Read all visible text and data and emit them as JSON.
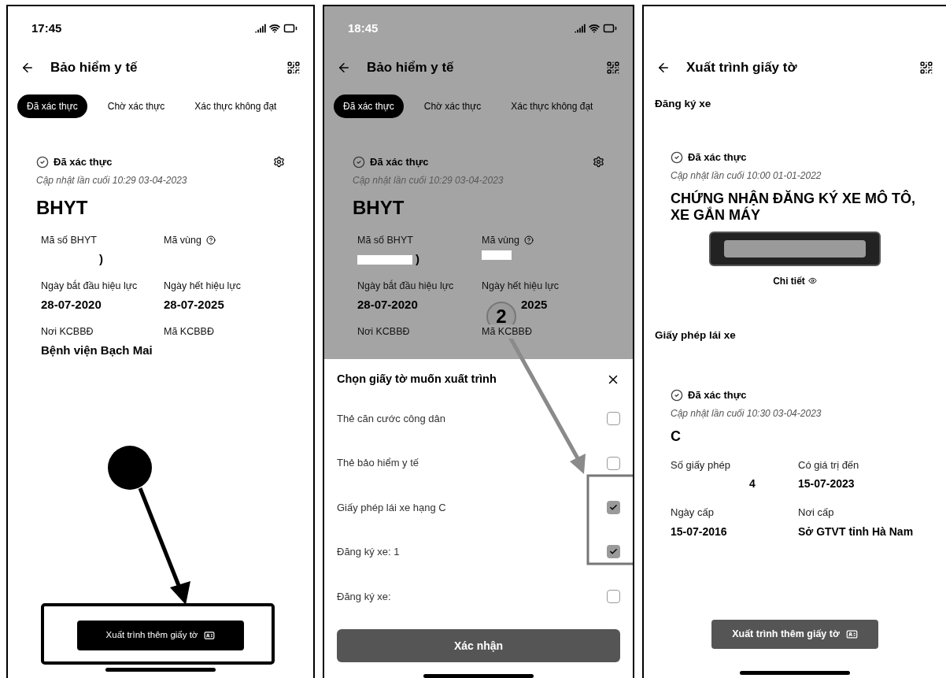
{
  "panels": [
    {
      "kind": "detail",
      "status_bar": {
        "time": "17:45"
      },
      "header": {
        "title": "Bảo hiểm y tế"
      },
      "tabs": [
        {
          "label": "Đã xác thực",
          "selected": true
        },
        {
          "label": "Chờ xác thực",
          "selected": false
        },
        {
          "label": "Xác thực không đạt",
          "selected": false
        }
      ],
      "card": {
        "status": "Đã xác thực",
        "updated": "Cập nhật lần cuối 10:29 03-04-2023",
        "title": "BHYT",
        "fields": [
          {
            "label": "Mã số BHYT",
            "value": ")",
            "redacted": true
          },
          {
            "label": "Mã vùng",
            "help": true
          },
          {
            "label": "Ngày bắt đầu hiệu lực",
            "value": "28-07-2020"
          },
          {
            "label": "Ngày hết hiệu lực",
            "value": "28-07-2025"
          },
          {
            "label": "Nơi KCBBĐ",
            "value": "Bệnh viện Bạch Mai"
          },
          {
            "label": "Mã KCBBĐ"
          }
        ]
      },
      "action_button": {
        "label": "Xuất trình thêm giấy tờ"
      },
      "annotation": {
        "kind": "button_callout"
      }
    },
    {
      "kind": "detail",
      "dimmed": true,
      "status_bar": {
        "time": "18:45"
      },
      "header": {
        "title": "Bảo hiểm y tế"
      },
      "tabs": [
        {
          "label": "Đã xác thực",
          "selected": true
        },
        {
          "label": "Chờ xác thực",
          "selected": false
        },
        {
          "label": "Xác thực không đạt",
          "selected": false
        }
      ],
      "card": {
        "status": "Đã xác thực",
        "updated": "Cập nhật lần cuối 10:29 03-04-2023",
        "title": "BHYT",
        "fields": [
          {
            "label": "Mã số BHYT",
            "value": ")",
            "redacted": true
          },
          {
            "label": "Mã vùng",
            "redacted": true,
            "help": true
          },
          {
            "label": "Ngày bắt đầu hiệu lực",
            "value": "28-07-2020"
          },
          {
            "label": "Ngày hết hiệu lực",
            "value": "2025",
            "covered": true
          },
          {
            "label": "Nơi KCBBĐ"
          },
          {
            "label": "Mã KCBBĐ"
          }
        ]
      },
      "sheet": {
        "title": "Chọn giấy tờ muốn xuất trình",
        "options": [
          {
            "label": "Thẻ căn cước công dân",
            "checked": false
          },
          {
            "label": "Thẻ bảo hiểm y tế",
            "checked": false
          },
          {
            "label": "Giấy phép lái xe hạng C",
            "checked": true
          },
          {
            "label": "Đăng ký xe: 1",
            "checked": true
          },
          {
            "label": "Đăng ký xe:",
            "checked": false
          }
        ],
        "confirm": "Xác nhận"
      },
      "annotation": {
        "kind": "checkbox_callout",
        "step": "2"
      }
    },
    {
      "kind": "presentation",
      "header": {
        "title": "Xuất trình giấy tờ"
      },
      "sections": [
        {
          "title": "Đăng ký xe",
          "card": {
            "status": "Đã xác thực",
            "updated": "Cập nhật lần cuối 10:00 01-01-2022",
            "title": "CHỨNG NHẬN ĐĂNG KÝ XE MÔ TÔ, XE GẮN MÁY",
            "plate": true,
            "detail_link": "Chi tiết"
          }
        },
        {
          "title": "Giấy phép lái xe",
          "card": {
            "status": "Đã xác thực",
            "updated": "Cập nhật lần cuối 10:30 03-04-2023",
            "title": "C",
            "fields": [
              {
                "label": "Số giấy phép",
                "value": "4",
                "redacted": true
              },
              {
                "label": "Có giá trị đến",
                "value": "15-07-2023"
              },
              {
                "label": "Ngày cấp",
                "value": "15-07-2016"
              },
              {
                "label": "Nơi cấp",
                "value": "Sở GTVT tỉnh Hà Nam"
              }
            ]
          }
        }
      ],
      "action_button": {
        "label": "Xuất trình thêm giấy tờ"
      }
    }
  ]
}
